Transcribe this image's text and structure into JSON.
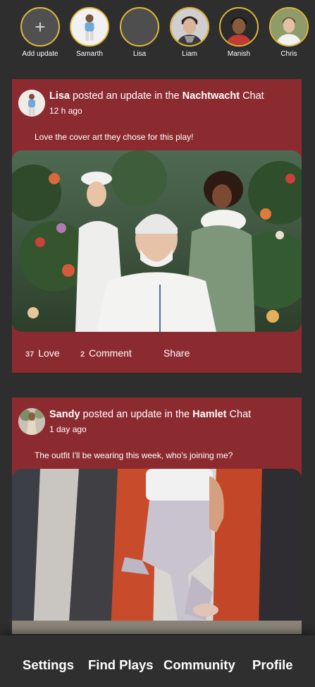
{
  "stories": [
    {
      "name": "Add update",
      "icon": "plus-icon"
    },
    {
      "name": "Samarth"
    },
    {
      "name": "Lisa"
    },
    {
      "name": "Liam"
    },
    {
      "name": "Manish"
    },
    {
      "name": "Chris"
    }
  ],
  "posts": [
    {
      "author": "Lisa",
      "action_text": " posted an update in the ",
      "chat": "Nachtwacht",
      "chat_suffix": " Chat",
      "time": "12 h ago",
      "caption": "Love the cover art they chose for this play!",
      "love_count": "37",
      "love_label": "Love",
      "comment_count": "2",
      "comment_label": "Comment",
      "share_label": "Share"
    },
    {
      "author": "Sandy",
      "action_text": " posted an update in the ",
      "chat": "Hamlet",
      "chat_suffix": " Chat",
      "time": "1 day ago",
      "caption": "The outfit I'll be wearing this week, who's joining me?"
    }
  ],
  "nav": {
    "settings": "Settings",
    "find_plays": "Find Plays",
    "community": "Community",
    "profile": "Profile"
  },
  "colors": {
    "background": "#2e2e2e",
    "card": "#8c2b2f",
    "story_ring": "#e2b739"
  }
}
